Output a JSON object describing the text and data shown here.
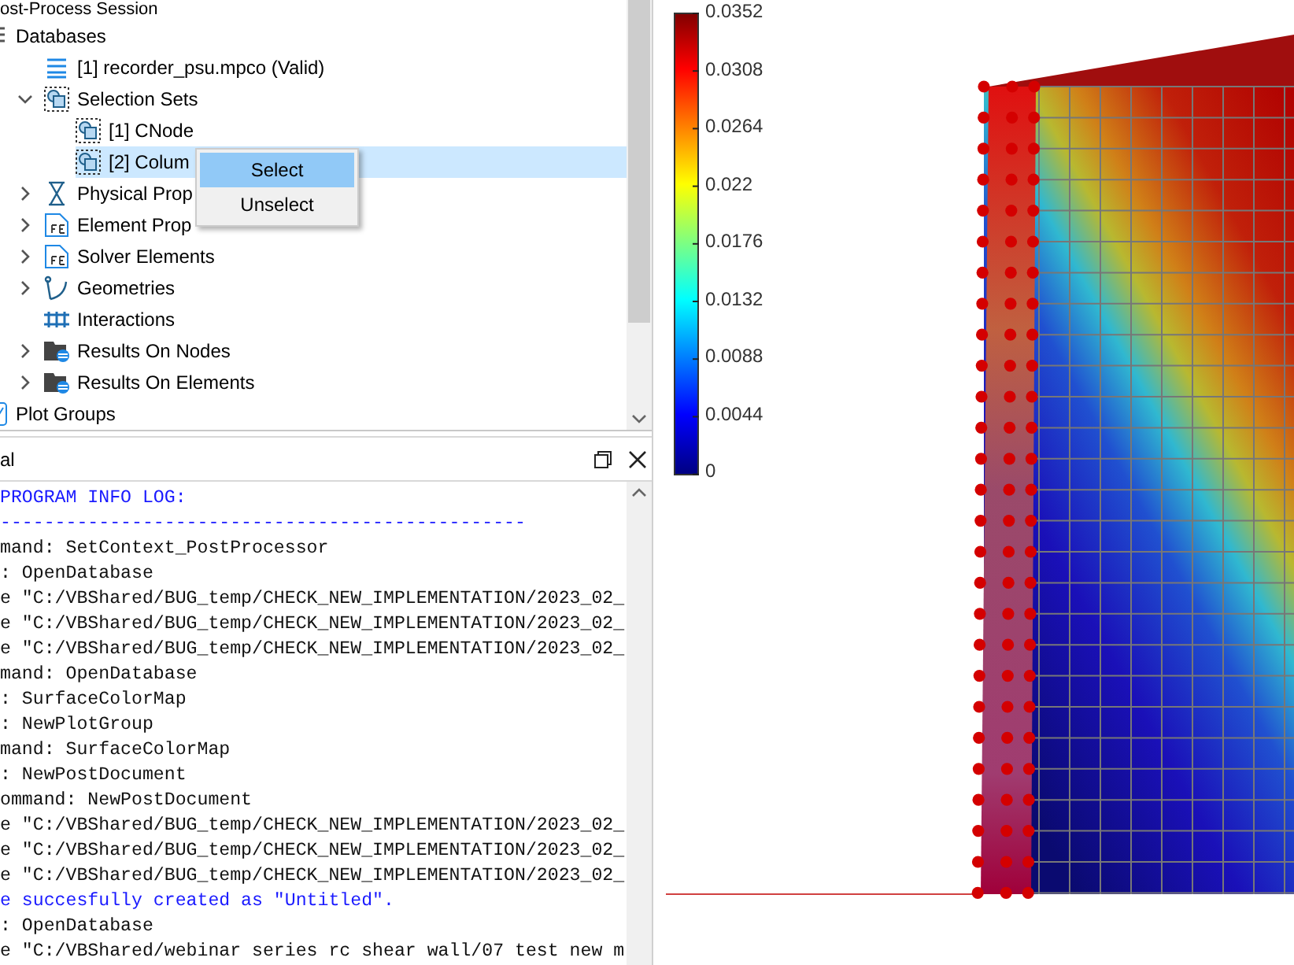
{
  "tree_panel": {
    "header": "ost-Process Session",
    "items": [
      {
        "label": "Databases",
        "kind": "list",
        "selected": false,
        "children": [
          {
            "label": "[1] recorder_psu.mpco (Valid)",
            "kind": "db",
            "selected": false
          },
          {
            "label": "Selection Sets",
            "kind": "set",
            "selected": false,
            "expanded": true,
            "children": [
              {
                "label": "[1] CNode",
                "kind": "set",
                "selected": false
              },
              {
                "label": "[2] Colum",
                "kind": "set",
                "selected": true
              }
            ]
          },
          {
            "label": "Physical Prop",
            "kind": "hourglass",
            "selected": false,
            "expanded": false
          },
          {
            "label": "Element Prop",
            "kind": "element",
            "selected": false,
            "expanded": false
          },
          {
            "label": "Solver Elements",
            "kind": "element",
            "selected": false,
            "expanded": false
          },
          {
            "label": "Geometries",
            "kind": "geometry",
            "selected": false,
            "expanded": false
          },
          {
            "label": "Interactions",
            "kind": "interaction",
            "selected": false
          },
          {
            "label": "Results On Nodes",
            "kind": "results",
            "selected": false,
            "expanded": false
          },
          {
            "label": "Results On Elements",
            "kind": "results",
            "selected": false,
            "expanded": false
          }
        ]
      },
      {
        "label": "Plot Groups",
        "kind": "plot",
        "selected": false
      }
    ]
  },
  "context_menu": [
    {
      "label": "Select",
      "selected": true
    },
    {
      "label": "Unselect",
      "selected": false
    }
  ],
  "terminal": {
    "title": "al",
    "lines": [
      {
        "text": "PROGRAM INFO LOG:",
        "kind": "info"
      },
      {
        "text": "------------------------------------------------",
        "kind": "info"
      },
      {
        "text": "mand: SetContext_PostProcessor",
        "kind": "plain"
      },
      {
        "text": ": OpenDatabase",
        "kind": "plain"
      },
      {
        "text": "e \"C:/VBShared/BUG_temp/CHECK_NEW_IMPLEMENTATION/2023_02_",
        "kind": "plain"
      },
      {
        "text": "e \"C:/VBShared/BUG_temp/CHECK_NEW_IMPLEMENTATION/2023_02_",
        "kind": "plain"
      },
      {
        "text": "e \"C:/VBShared/BUG_temp/CHECK_NEW_IMPLEMENTATION/2023_02_",
        "kind": "plain"
      },
      {
        "text": "mand: OpenDatabase",
        "kind": "plain"
      },
      {
        "text": ": SurfaceColorMap",
        "kind": "plain"
      },
      {
        "text": ": NewPlotGroup",
        "kind": "plain"
      },
      {
        "text": "mand: SurfaceColorMap",
        "kind": "plain"
      },
      {
        "text": ": NewPostDocument",
        "kind": "plain"
      },
      {
        "text": "ommand: NewPostDocument",
        "kind": "plain"
      },
      {
        "text": "e \"C:/VBShared/BUG_temp/CHECK_NEW_IMPLEMENTATION/2023_02_",
        "kind": "plain"
      },
      {
        "text": "e \"C:/VBShared/BUG_temp/CHECK_NEW_IMPLEMENTATION/2023_02_",
        "kind": "plain"
      },
      {
        "text": "e \"C:/VBShared/BUG_temp/CHECK_NEW_IMPLEMENTATION/2023_02_",
        "kind": "plain"
      },
      {
        "text": "e succesfully created as \"Untitled\".",
        "kind": "info"
      },
      {
        "text": ": OpenDatabase",
        "kind": "plain"
      },
      {
        "text": "e \"C:/VBShared/webinar series rc shear wall/07 test new m",
        "kind": "plain"
      }
    ]
  },
  "viewport": {
    "legend": {
      "ticks": [
        "0.0352",
        "0.0308",
        "0.0264",
        "0.022",
        "0.0176",
        "0.0132",
        "0.0088",
        "0.0044",
        "0"
      ]
    }
  }
}
